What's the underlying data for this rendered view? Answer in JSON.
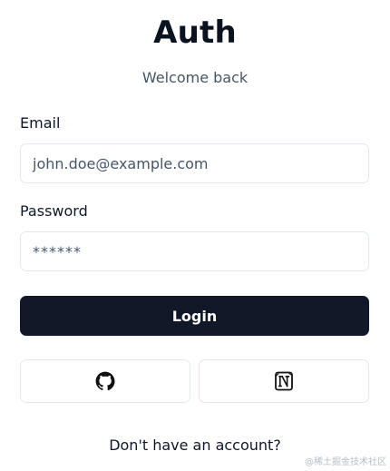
{
  "header": {
    "title": "Auth",
    "subtitle": "Welcome back"
  },
  "form": {
    "email_label": "Email",
    "email_value": "john.doe@example.com",
    "password_label": "Password",
    "password_value": "******",
    "login_label": "Login"
  },
  "oauth": {
    "providers": [
      {
        "icon": "github-icon"
      },
      {
        "icon": "notion-icon"
      }
    ]
  },
  "footer": {
    "signup_prompt": "Don't have an account?"
  },
  "watermark": {
    "text": "@稀土掘金技术社区"
  },
  "colors": {
    "primary": "#111827",
    "border": "#e2e8f0",
    "muted_text": "#475569"
  }
}
